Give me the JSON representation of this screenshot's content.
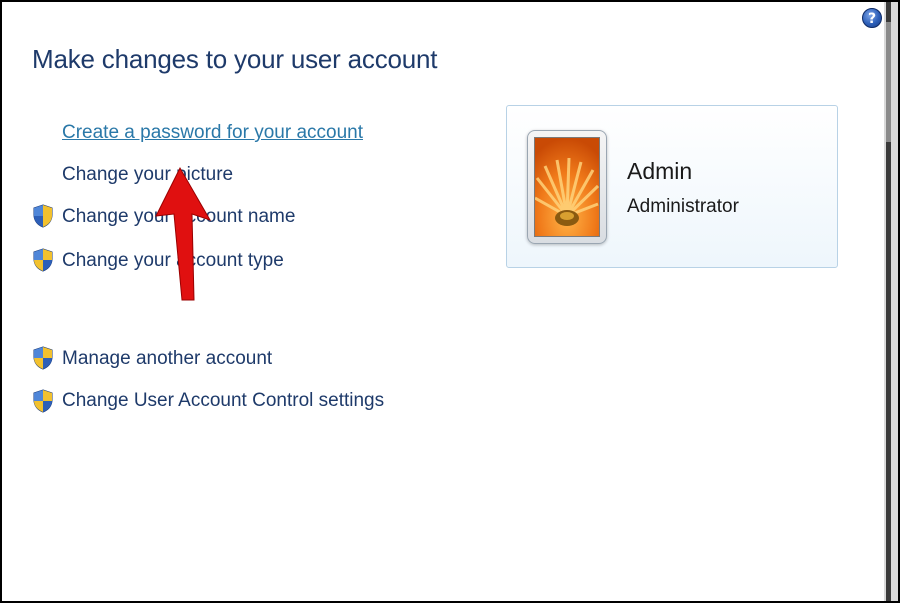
{
  "page": {
    "title": "Make changes to your user account",
    "help_label": "?"
  },
  "tasks": [
    {
      "label": "Create a password for your account",
      "shield": false,
      "highlighted": true
    },
    {
      "label": "Change your picture",
      "shield": false,
      "highlighted": false
    },
    {
      "label": "Change your account name",
      "shield": true,
      "highlighted": false
    },
    {
      "label": "Change your account type",
      "shield": true,
      "highlighted": false
    }
  ],
  "other_tasks": [
    {
      "label": "Manage another account",
      "shield": true
    },
    {
      "label": "Change User Account Control settings",
      "shield": true
    }
  ],
  "user": {
    "name": "Admin",
    "role": "Administrator",
    "picture": "orange-flower"
  },
  "annotation": {
    "type": "red-arrow",
    "color": "#e01010"
  },
  "colors": {
    "link": "#1e3a6a",
    "link_highlight": "#2a78a8",
    "card_border": "#b8d2e6"
  }
}
